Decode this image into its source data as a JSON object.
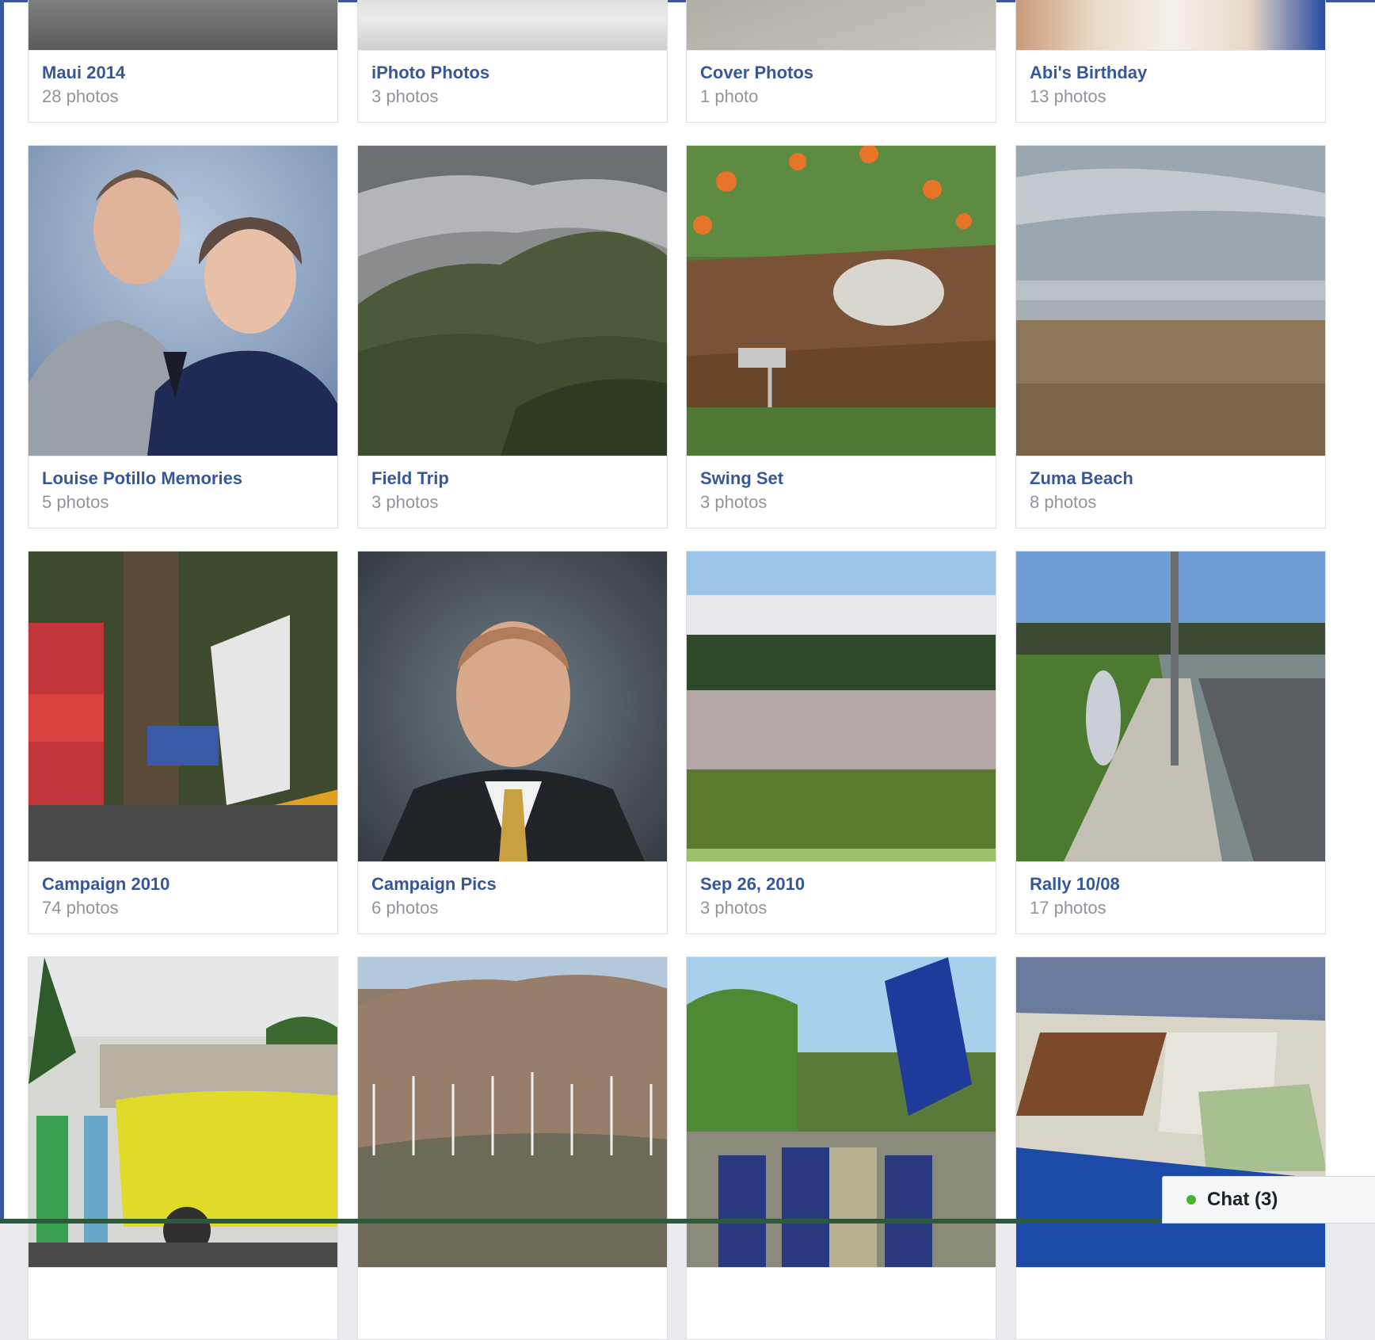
{
  "albums": [
    {
      "title": "Maui 2014",
      "count": "28 photos"
    },
    {
      "title": "iPhoto Photos",
      "count": "3 photos"
    },
    {
      "title": "Cover Photos",
      "count": "1 photo"
    },
    {
      "title": "Abi's Birthday",
      "count": "13 photos"
    },
    {
      "title": "Louise Potillo Memories",
      "count": "5 photos"
    },
    {
      "title": "Field Trip",
      "count": "3 photos"
    },
    {
      "title": "Swing Set",
      "count": "3 photos"
    },
    {
      "title": "Zuma Beach",
      "count": "8 photos"
    },
    {
      "title": "Campaign 2010",
      "count": "74 photos"
    },
    {
      "title": "Campaign Pics",
      "count": "6 photos"
    },
    {
      "title": "Sep 26, 2010",
      "count": "3 photos"
    },
    {
      "title": "Rally 10/08",
      "count": "17 photos"
    },
    {
      "title": "",
      "count": ""
    },
    {
      "title": "",
      "count": ""
    },
    {
      "title": "",
      "count": ""
    },
    {
      "title": "",
      "count": ""
    }
  ],
  "chat": {
    "label": "Chat (3)",
    "status_color": "#42b72a"
  },
  "colors": {
    "link": "#365899",
    "meta": "#90949c",
    "brand": "#3b5998"
  }
}
